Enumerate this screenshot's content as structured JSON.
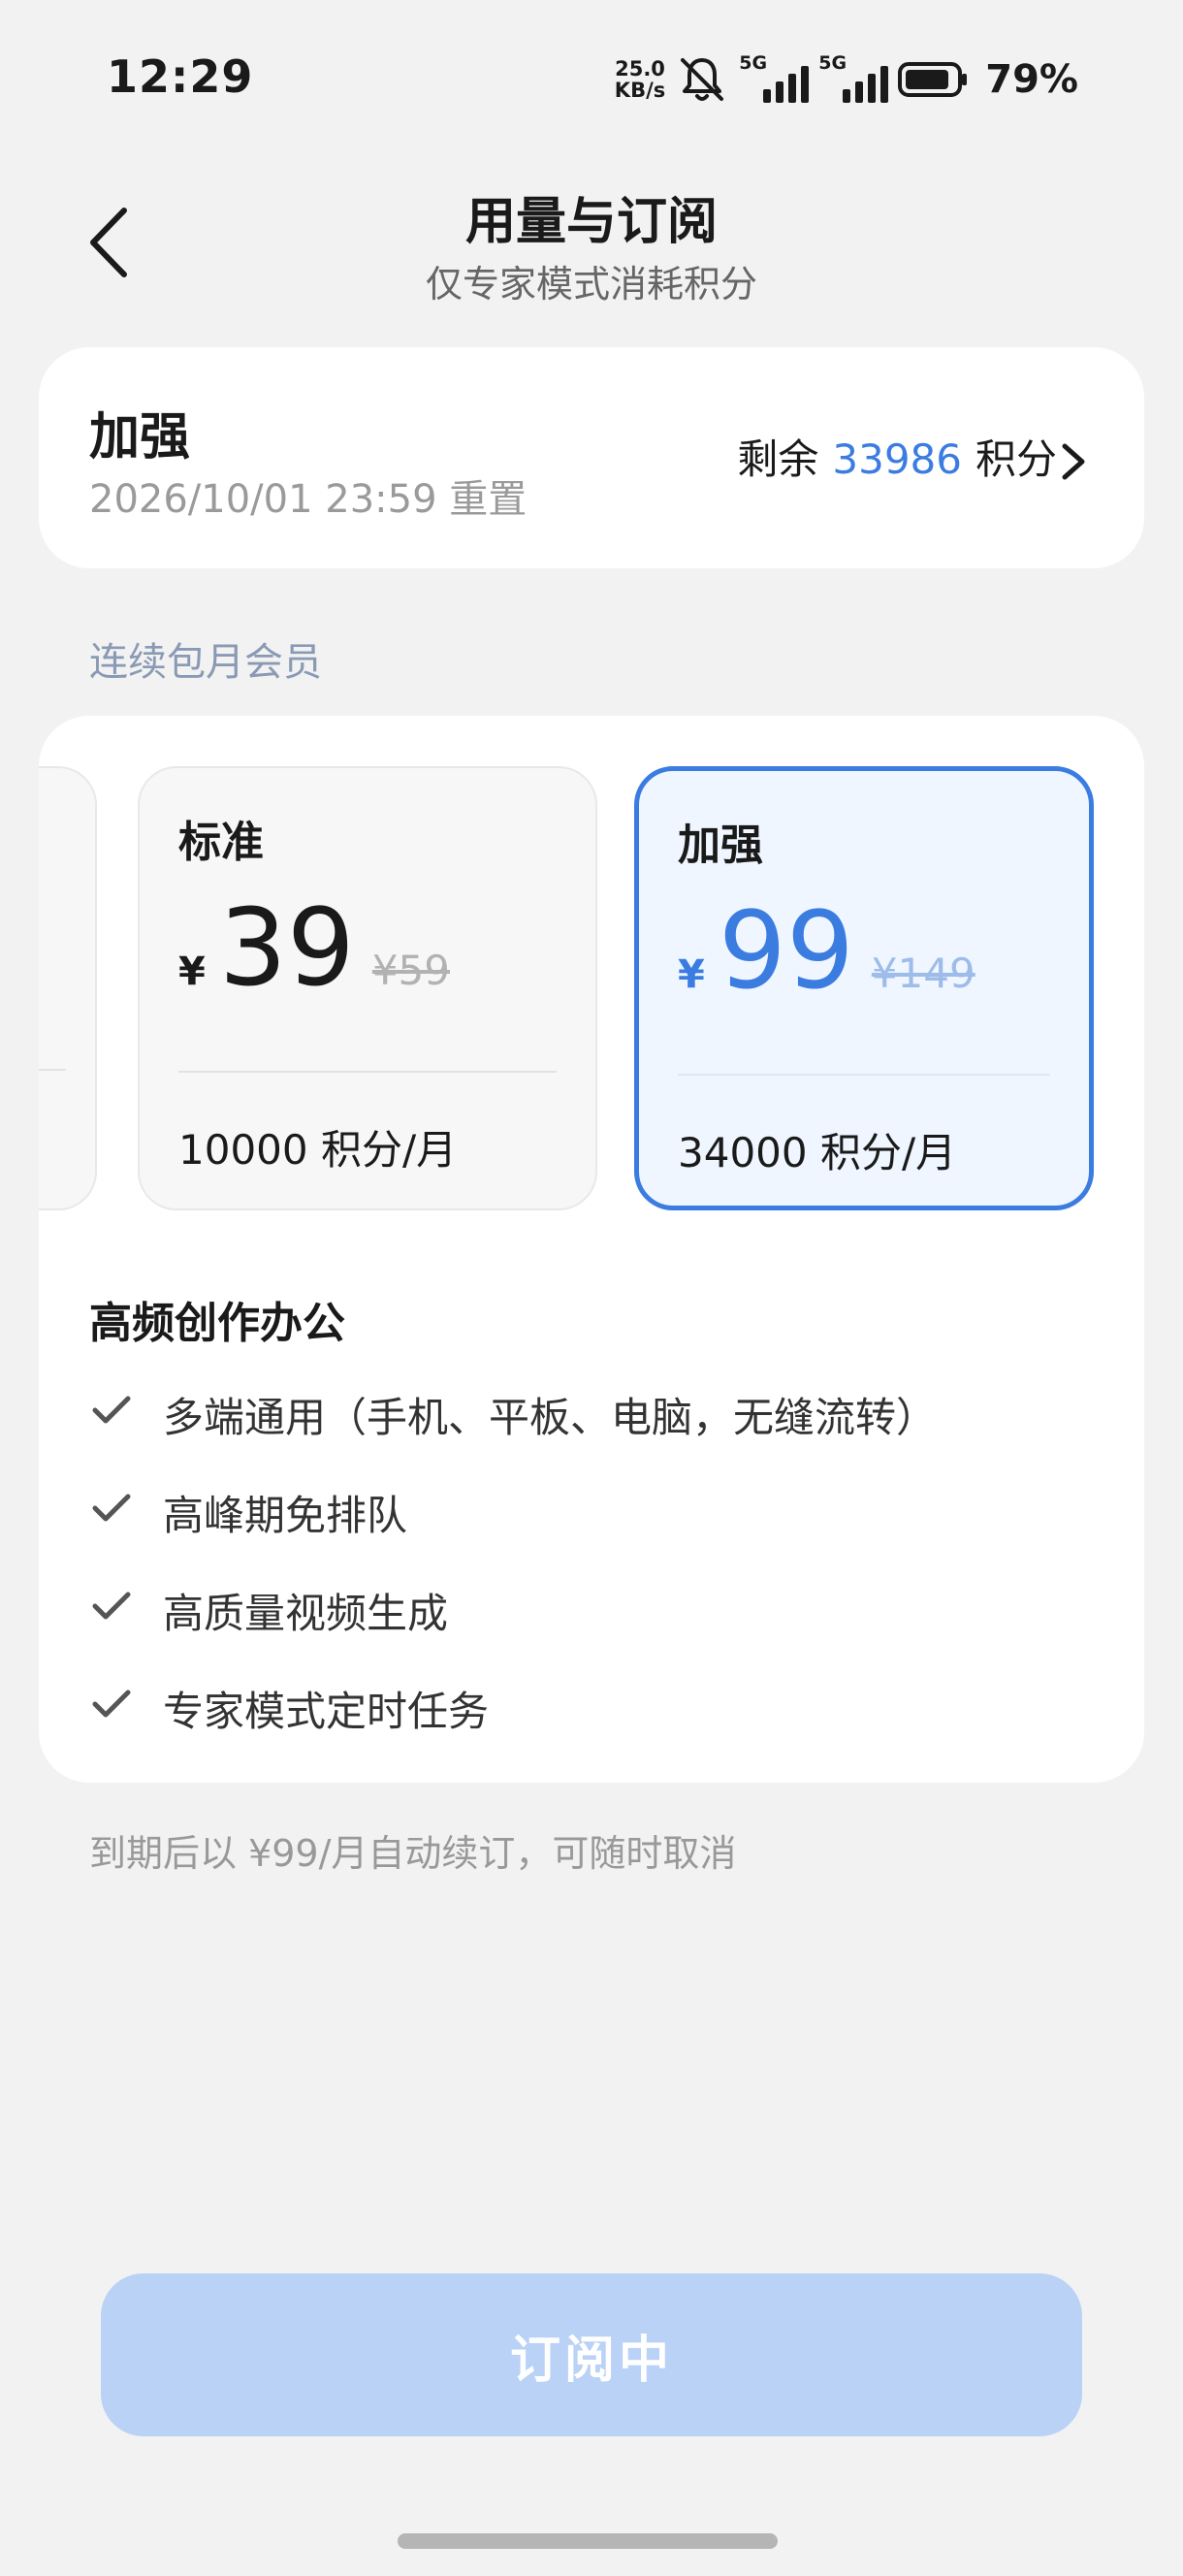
{
  "status_bar": {
    "time": "12:29",
    "net_speed_value": "25.0",
    "net_speed_unit": "KB/s",
    "signal1_label": "5G",
    "signal2_label": "5G",
    "battery_percent": "79%"
  },
  "header": {
    "title": "用量与订阅",
    "subtitle": "仅专家模式消耗积分"
  },
  "usage": {
    "plan_name": "加强",
    "reset_info": "2026/10/01 23:59 重置",
    "remaining_prefix": "剩余",
    "remaining_value": "33986",
    "remaining_suffix": "积分"
  },
  "subscription": {
    "section_label": "连续包月会员",
    "plans": [
      {
        "name": "标准",
        "currency": "¥",
        "price": "39",
        "original_price": "¥59",
        "credits": "10000 积分/月",
        "selected": false
      },
      {
        "name": "加强",
        "currency": "¥",
        "price": "99",
        "original_price": "¥149",
        "credits": "34000 积分/月",
        "selected": true
      }
    ],
    "benefits_title": "高频创作办公",
    "benefits": [
      "多端通用（手机、平板、电脑，无缝流转）",
      "高峰期免排队",
      "高质量视频生成",
      "专家模式定时任务"
    ],
    "renew_note": "到期后以 ¥99/月自动续订，可随时取消",
    "subscribe_button": "订阅中"
  },
  "colors": {
    "accent": "#3b7ce0",
    "button_disabled": "#b9d2f6",
    "background": "#f2f2f2"
  }
}
